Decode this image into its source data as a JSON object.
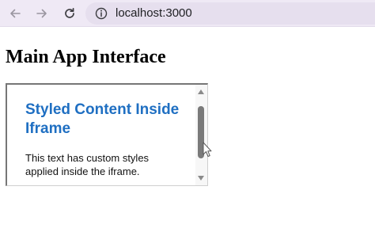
{
  "browser": {
    "url": "localhost:3000",
    "icons": {
      "back": "arrow-left-icon",
      "forward": "arrow-right-icon",
      "reload": "reload-icon",
      "site_info": "site-info-icon"
    }
  },
  "page": {
    "heading": "Main App Interface"
  },
  "iframe": {
    "heading": "Styled Content Inside Iframe",
    "text": "This text has custom styles applied inside the iframe.",
    "heading_color": "#1f6fc2"
  }
}
